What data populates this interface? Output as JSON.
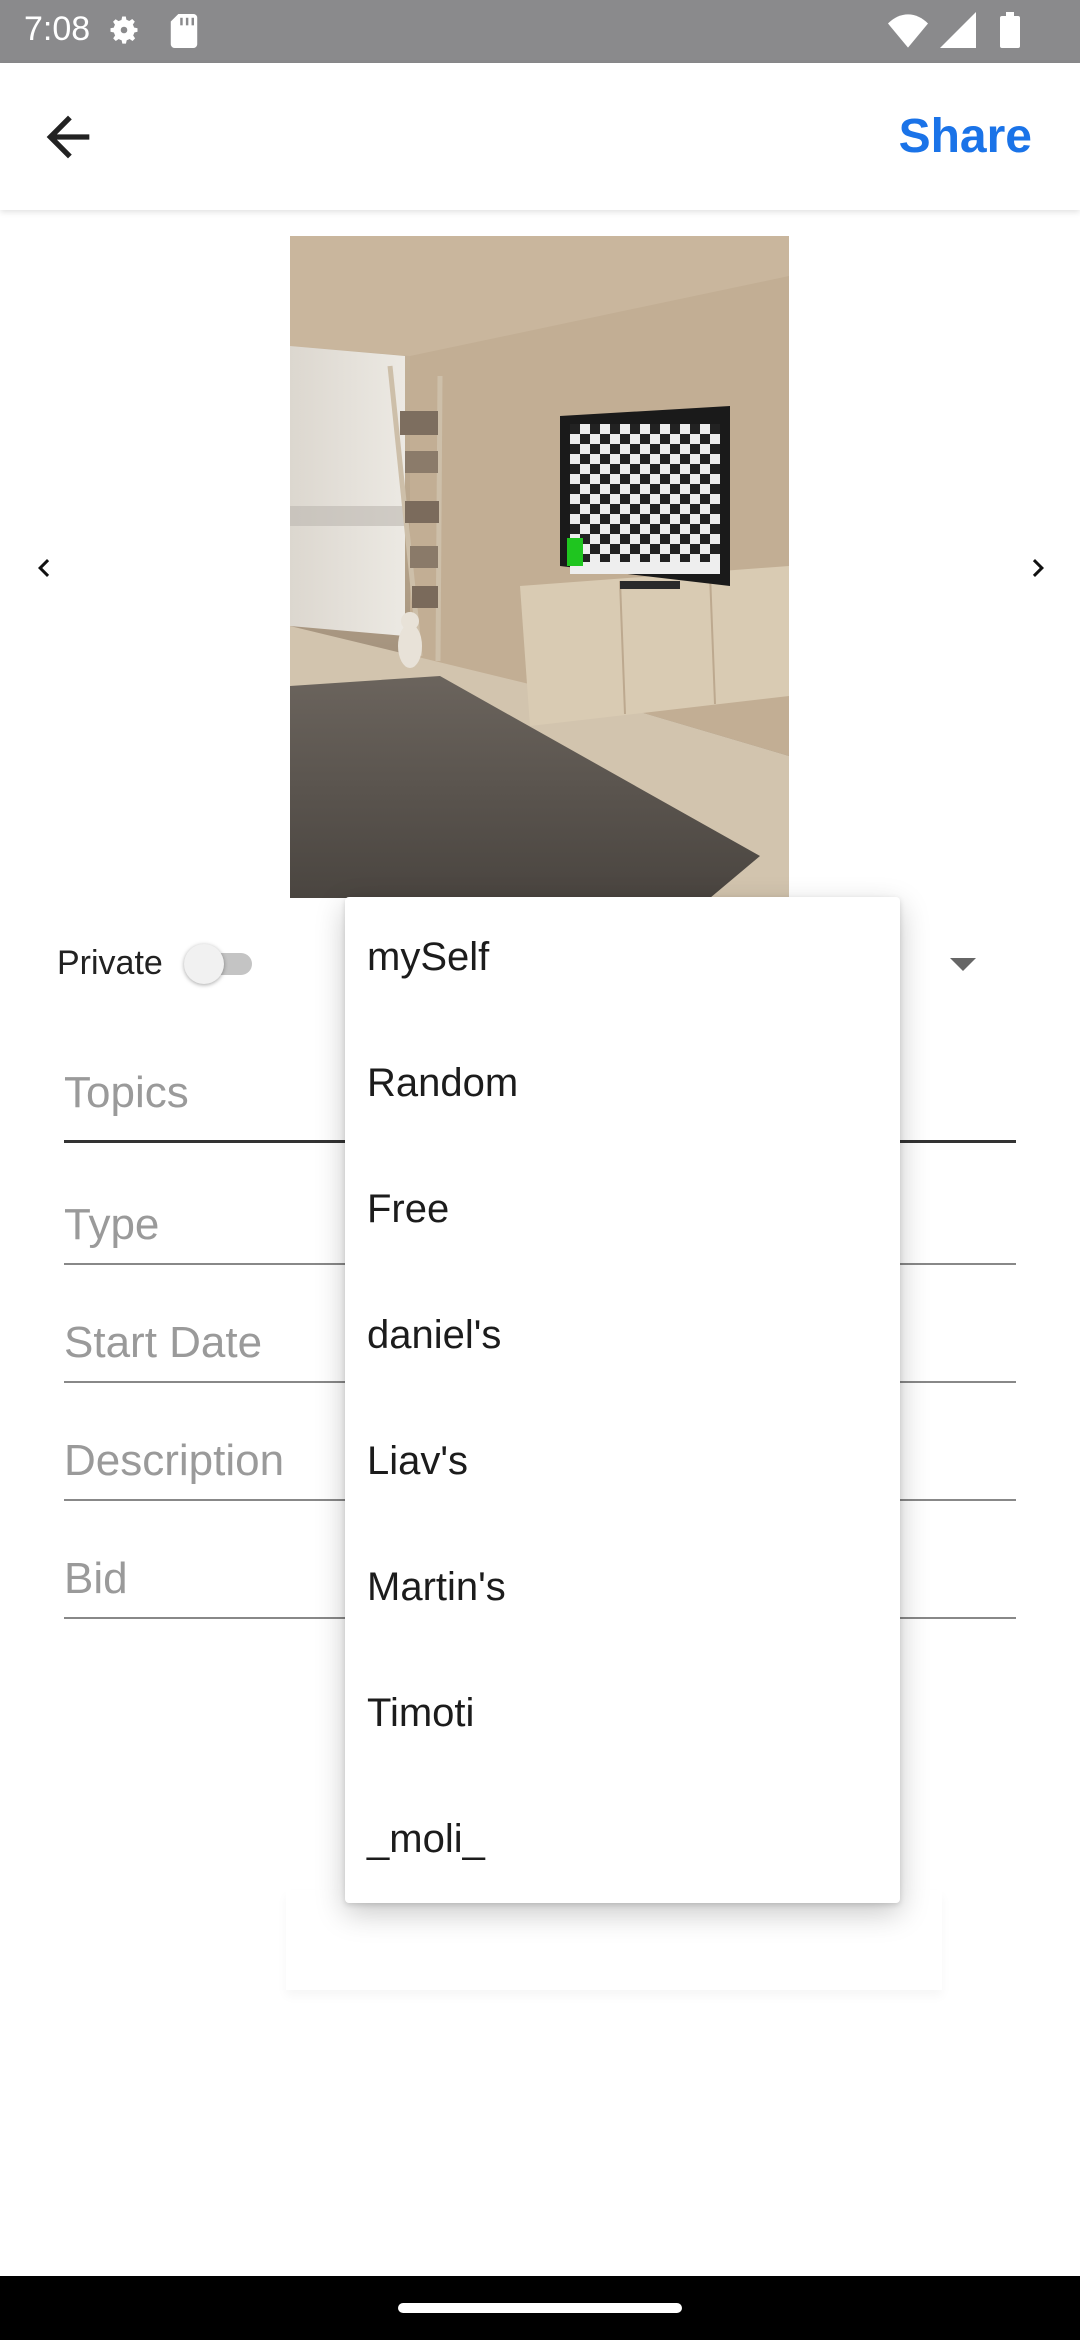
{
  "status_bar": {
    "time": "7:08"
  },
  "app_bar": {
    "share_label": "Share"
  },
  "form": {
    "private_label": "Private",
    "private_on": false,
    "topics_placeholder": "Topics",
    "type_placeholder": "Type",
    "start_date_placeholder": "Start Date",
    "description_placeholder": "Description",
    "bid_placeholder": "Bid"
  },
  "dropdown": {
    "items": [
      {
        "label": "mySelf"
      },
      {
        "label": "Random"
      },
      {
        "label": "Free"
      },
      {
        "label": "daniel's"
      },
      {
        "label": "Liav's"
      },
      {
        "label": "Martin's"
      },
      {
        "label": "Timoti"
      },
      {
        "label": "_moli_"
      }
    ]
  },
  "colors": {
    "accent": "#1a73e8",
    "status_bar": "#8a8a8c"
  },
  "icons": {
    "back": "arrow-left-icon",
    "prev": "chevron-left-icon",
    "next": "chevron-right-icon",
    "dropdown": "caret-down-icon"
  }
}
